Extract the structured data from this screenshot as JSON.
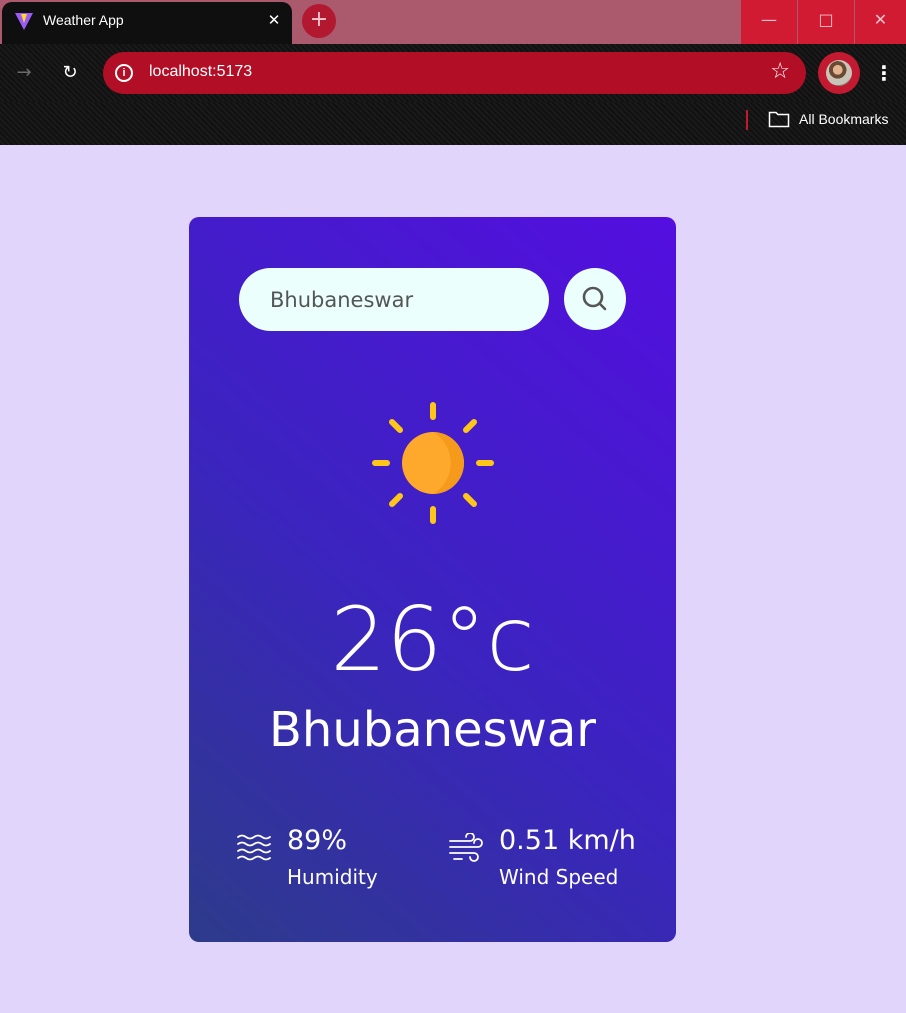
{
  "browser": {
    "tab_title": "Weather App",
    "tab_close": "✕",
    "new_tab": "+",
    "url": "localhost:5173",
    "bookmarks_label": "All Bookmarks",
    "icons": [
      "vite-favicon-icon",
      "close-icon",
      "plus-icon",
      "minimize-icon",
      "maximize-icon",
      "window-close-icon",
      "forward-icon",
      "reload-icon",
      "info-icon",
      "star-icon",
      "avatar",
      "menu-dots-icon",
      "folder-icon"
    ],
    "accent_color": "#c41a31"
  },
  "weather": {
    "search_value": "Bhubaneswar",
    "temperature": "26°c",
    "city": "Bhubaneswar",
    "humidity_value": "89%",
    "humidity_label": "Humidity",
    "wind_value": "0.51 km/h",
    "wind_label": "Wind Speed",
    "condition_icon": "sun-icon",
    "card_gradient": [
      "#540ee0",
      "#2d3b8a"
    ],
    "page_background": "#e2d5fb"
  }
}
